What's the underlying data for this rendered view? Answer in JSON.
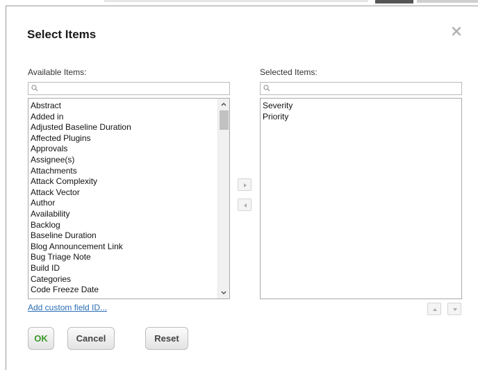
{
  "dialog": {
    "title": "Select Items",
    "close_icon": "close-icon"
  },
  "available": {
    "label": "Available Items:",
    "search_placeholder": "",
    "items": [
      "Abstract",
      "Added in",
      "Adjusted Baseline Duration",
      "Affected Plugins",
      "Approvals",
      "Assignee(s)",
      "Attachments",
      "Attack Complexity",
      "Attack Vector",
      "Author",
      "Availability",
      "Backlog",
      "Baseline Duration",
      "Blog Announcement Link",
      "Bug Triage Note",
      "Build ID",
      "Categories",
      "Code Freeze Date"
    ],
    "add_custom_link": "Add custom field ID..."
  },
  "selected": {
    "label": "Selected Items:",
    "search_placeholder": "",
    "items": [
      "Severity",
      "Priority"
    ]
  },
  "transfer": {
    "add_icon": "arrow-right-icon",
    "remove_icon": "arrow-left-icon",
    "move_up_icon": "arrow-up-icon",
    "move_down_icon": "arrow-down-icon"
  },
  "buttons": {
    "ok": "OK",
    "cancel": "Cancel",
    "reset": "Reset"
  },
  "colors": {
    "ok_text": "#3a9a2a",
    "link": "#2a6db4"
  }
}
